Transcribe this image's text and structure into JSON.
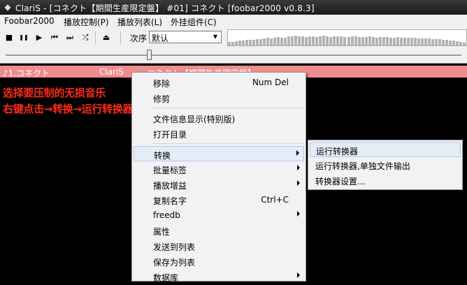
{
  "window": {
    "title": "ClariS - [コネクト【期間生産限定盤】 #01] コネクト     [foobar2000 v0.8.3]"
  },
  "menubar": {
    "items": [
      "Foobar2000",
      "播放控制(P)",
      "播放列表(L)",
      "外挂组件(C)"
    ]
  },
  "toolbar": {
    "buttons": [
      {
        "name": "stop-icon",
        "glyph": "■"
      },
      {
        "name": "pause-icon",
        "glyph": "❚❚"
      },
      {
        "name": "play-icon",
        "glyph": "▶"
      },
      {
        "name": "previous-icon",
        "glyph": "⏮"
      },
      {
        "name": "next-icon",
        "glyph": "⏭"
      },
      {
        "name": "random-icon",
        "glyph": "⤮"
      },
      {
        "name": "eject-icon",
        "glyph": "⏏"
      }
    ],
    "order_label": "次序",
    "order_value": "默认"
  },
  "visualization": {
    "levels": [
      0.22,
      0.25,
      0.28,
      0.3,
      0.33,
      0.35,
      0.38,
      0.36,
      0.4,
      0.42,
      0.45,
      0.48,
      0.46,
      0.5,
      0.55,
      0.52,
      0.5,
      0.58,
      0.6,
      0.62,
      0.6,
      0.57,
      0.55,
      0.6,
      0.58,
      0.56,
      0.6,
      0.62,
      0.58,
      0.55,
      0.57,
      0.6,
      0.58,
      0.55,
      0.56,
      0.57,
      0.58,
      0.55,
      0.53,
      0.56,
      0.58,
      0.55,
      0.52,
      0.54,
      0.55,
      0.53,
      0.5,
      0.52,
      0.54,
      0.5,
      0.48,
      0.5,
      0.52,
      0.5,
      0.47,
      0.46,
      0.45,
      0.44,
      0.43,
      0.42,
      0.4,
      0.38,
      0.35,
      0.33,
      0.3,
      0.28,
      0.25,
      0.2
    ]
  },
  "seek": {
    "position_fraction": 0.31
  },
  "playlist": {
    "track": {
      "title": "♪1.コネクト",
      "artist": "ClariS",
      "album": "コネクト【期間生産限定盤】"
    }
  },
  "annotation": {
    "line1": "选择要压制的无损音乐",
    "line2": "右键点击→转换→运行转换器"
  },
  "context_menu": {
    "items": [
      {
        "label": "移除",
        "shortcut": "Num Del"
      },
      {
        "label": "修剪"
      },
      {
        "separator": true
      },
      {
        "label": "文件信息显示(特别版)"
      },
      {
        "label": "打开目录"
      },
      {
        "separator": true
      },
      {
        "label": "转换",
        "submenu": true,
        "highlighted": true
      },
      {
        "label": "批量标签",
        "submenu": true
      },
      {
        "label": "播放增益",
        "submenu": true
      },
      {
        "label": "复制名字",
        "shortcut": "Ctrl+C"
      },
      {
        "label": "freedb",
        "submenu": true
      },
      {
        "label": "属性"
      },
      {
        "label": "发送到列表"
      },
      {
        "label": "保存为列表"
      },
      {
        "label": "数据库",
        "submenu": true
      }
    ]
  },
  "submenu": {
    "items": [
      {
        "label": "运行转换器",
        "highlighted": true
      },
      {
        "label": "运行转换器,单独文件输出"
      },
      {
        "label": "转换器设置..."
      }
    ]
  },
  "colors": {
    "selected_track": "#f08c8c",
    "annotation": "#ff2a1a",
    "menu_highlight": "#e4ecf7"
  }
}
